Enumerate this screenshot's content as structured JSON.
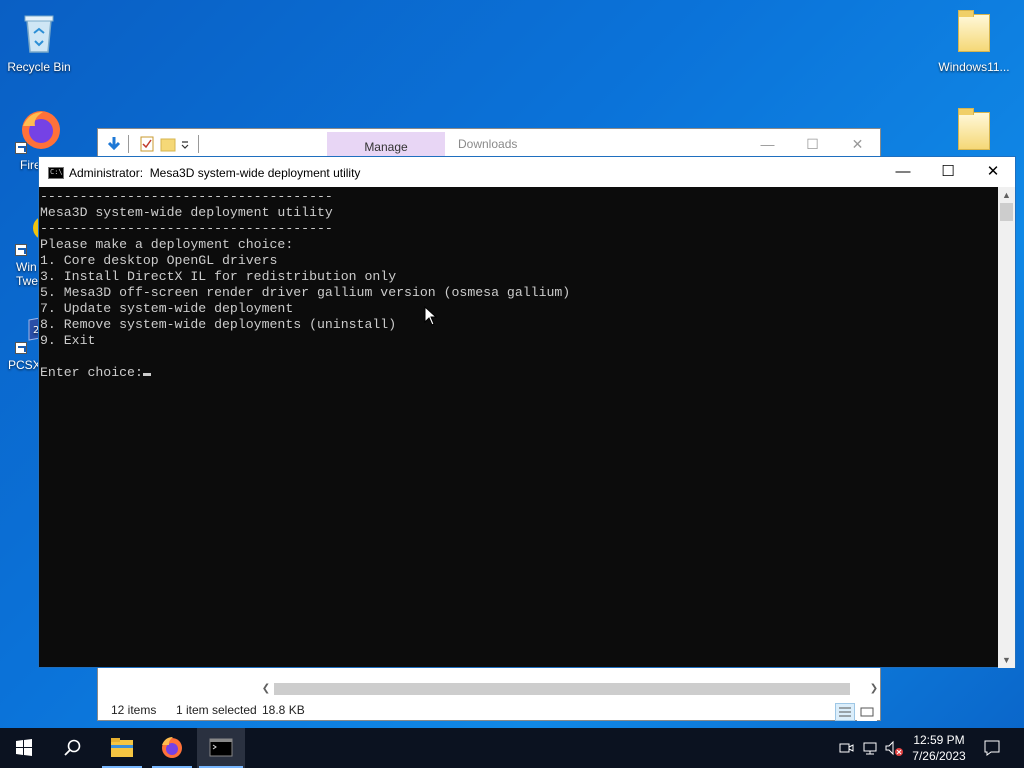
{
  "desktop": {
    "icons": [
      {
        "label": "Recycle Bin",
        "icon": "recycle-bin-icon"
      },
      {
        "label": "Fire",
        "icon": "firefox-icon"
      },
      {
        "label": "Win Twe",
        "icon": "winaero-tweaker-icon"
      },
      {
        "label": "PCSX",
        "icon": "pcsx2-icon"
      },
      {
        "label": "Windows11...",
        "icon": "folder-icon"
      },
      {
        "label": "",
        "icon": "folder-icon"
      }
    ]
  },
  "explorer": {
    "tab_manage": "Manage",
    "title": "Downloads",
    "status_items": "12 items",
    "status_selected": "1 item selected",
    "status_size": "18.8 KB",
    "minimize_glyph": "—",
    "maximize_glyph": "☐",
    "close_glyph": "✕"
  },
  "console": {
    "title": "Administrator:  Mesa3D system-wide deployment utility",
    "minimize_glyph": "—",
    "maximize_glyph": "☐",
    "close_glyph": "✕",
    "lines": [
      "-------------------------------------",
      "Mesa3D system-wide deployment utility",
      "-------------------------------------",
      "Please make a deployment choice:",
      "1. Core desktop OpenGL drivers",
      "3. Install DirectX IL for redistribution only",
      "5. Mesa3D off-screen render driver gallium version (osmesa gallium)",
      "7. Update system-wide deployment",
      "8. Remove system-wide deployments (uninstall)",
      "9. Exit",
      ""
    ],
    "prompt": "Enter choice:"
  },
  "taskbar": {
    "time": "12:59 PM",
    "date": "7/26/2023",
    "apps": [
      "start-icon",
      "search-icon",
      "file-explorer-icon",
      "firefox-icon",
      "command-prompt-icon"
    ],
    "active_app": "command-prompt-icon"
  },
  "colors": {
    "desktop": "#0b6fd6",
    "console_bg": "#0c0c0c",
    "console_text": "#cccccc",
    "manage_tab": "#e8d6f5",
    "taskbar": "#0b1220"
  }
}
